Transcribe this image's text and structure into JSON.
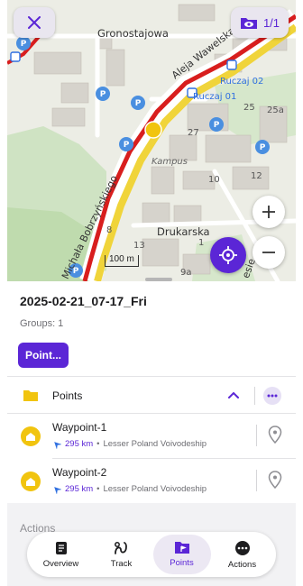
{
  "map": {
    "street_labels": [
      "Gronostajowa",
      "Aleja Wawelska",
      "Drukarska",
      "Michała Bobrzyńskiego",
      "Kampus",
      "esie"
    ],
    "stop_labels": [
      "Ruczaj 02",
      "Ruczaj 01"
    ],
    "house_numbers": [
      "25",
      "25a",
      "27",
      "10",
      "12",
      "13",
      "9a",
      "8",
      "1"
    ],
    "scale_text": "100 m"
  },
  "layers": {
    "count": "1/1"
  },
  "track": {
    "title": "2025-02-21_07-17_Fri"
  },
  "groups": {
    "label": "Groups: 1"
  },
  "point_button": {
    "label": "Point..."
  },
  "group": {
    "name": "Points"
  },
  "waypoints": [
    {
      "name": "Waypoint-1",
      "distance": "295 km",
      "region": "Lesser Poland Voivodeship"
    },
    {
      "name": "Waypoint-2",
      "distance": "295 km",
      "region": "Lesser Poland Voivodeship"
    }
  ],
  "actions_section": {
    "label": "Actions"
  },
  "nav": [
    {
      "label": "Overview",
      "icon": "document-icon"
    },
    {
      "label": "Track",
      "icon": "route-icon"
    },
    {
      "label": "Points",
      "icon": "points-folder-icon",
      "active": true
    },
    {
      "label": "Actions",
      "icon": "more-icon"
    }
  ],
  "colors": {
    "accent": "#5b26d6",
    "route": "#d81e1e",
    "tram": "#f0d43a",
    "waypoint": "#f1c40f"
  }
}
